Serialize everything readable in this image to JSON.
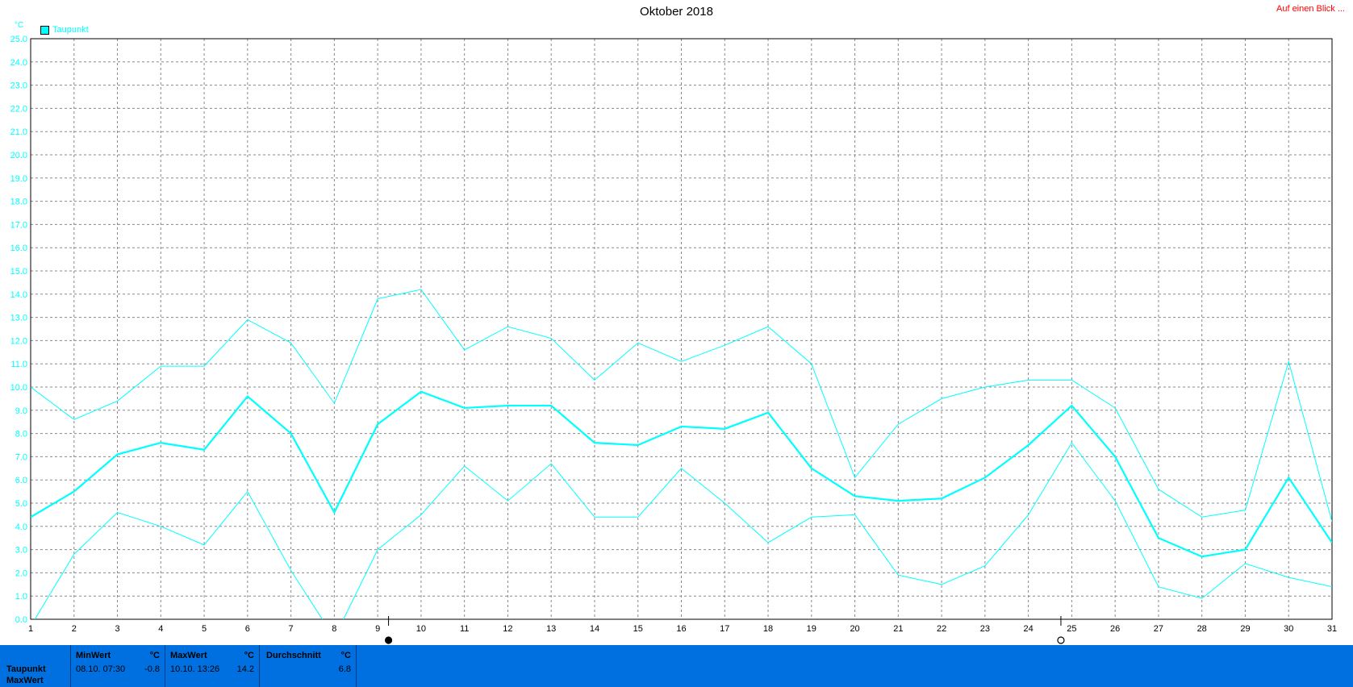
{
  "header": {
    "title": "Oktober 2018",
    "link": "Auf einen Blick ...",
    "unit": "°C",
    "legend": "Taupunkt"
  },
  "colors": {
    "series": "#00ffff",
    "panel": "#0070e0",
    "link": "#ff0000"
  },
  "chart_data": {
    "type": "line",
    "title": "Oktober 2018",
    "ylabel": "°C",
    "ylim": [
      0,
      25
    ],
    "yticks": [
      "0.0",
      "1.0",
      "2.0",
      "3.0",
      "4.0",
      "5.0",
      "6.0",
      "7.0",
      "8.0",
      "9.0",
      "10.0",
      "11.0",
      "12.0",
      "13.0",
      "14.0",
      "15.0",
      "16.0",
      "17.0",
      "18.0",
      "19.0",
      "20.0",
      "21.0",
      "22.0",
      "23.0",
      "24.0",
      "25.0"
    ],
    "x": [
      1,
      2,
      3,
      4,
      5,
      6,
      7,
      8,
      9,
      10,
      11,
      12,
      13,
      14,
      15,
      16,
      17,
      18,
      19,
      20,
      21,
      22,
      23,
      24,
      25,
      26,
      27,
      28,
      29,
      30,
      31
    ],
    "grid": true,
    "legend_position": "top-left",
    "series": [
      {
        "name": "Taupunkt",
        "values": [
          4.4,
          5.5,
          7.1,
          7.6,
          7.3,
          9.6,
          8.0,
          4.6,
          8.4,
          9.8,
          9.1,
          9.2,
          9.2,
          7.6,
          7.5,
          8.3,
          8.2,
          8.9,
          6.5,
          5.3,
          5.1,
          5.2,
          6.1,
          7.5,
          9.2,
          7.0,
          3.5,
          2.7,
          3.0,
          6.1,
          3.3
        ]
      },
      {
        "values": [
          10.0,
          8.6,
          9.4,
          10.9,
          10.9,
          12.9,
          11.9,
          9.3,
          13.8,
          14.2,
          11.6,
          12.6,
          12.1,
          10.3,
          11.9,
          11.1,
          11.8,
          12.6,
          11.0,
          6.1,
          8.4,
          9.5,
          10.0,
          10.3,
          10.3,
          9.1,
          5.6,
          4.4,
          4.7,
          11.1,
          4.2
        ]
      },
      {
        "values": [
          -0.3,
          2.8,
          4.6,
          4.0,
          3.2,
          5.5,
          2.1,
          -0.8,
          3.0,
          4.5,
          6.6,
          5.1,
          6.7,
          4.4,
          4.4,
          6.5,
          5.0,
          3.3,
          4.4,
          4.5,
          1.9,
          1.5,
          2.3,
          4.5,
          7.6,
          5.1,
          1.4,
          0.9,
          2.4,
          1.8,
          1.4
        ]
      }
    ],
    "moon_markers": [
      {
        "x": 9.25,
        "phase": "new-moon"
      },
      {
        "x": 24.75,
        "phase": "full-moon"
      }
    ]
  },
  "stats": {
    "row_labels": [
      "Taupunkt",
      "MaxWert"
    ],
    "min": {
      "label": "MinWert",
      "unit": "°C",
      "time": "08.10.  07:30",
      "value": "-0.8"
    },
    "max": {
      "label": "MaxWert",
      "unit": "°C",
      "time": "10.10.  13:26",
      "value": "14.2"
    },
    "avg": {
      "label": "Durchschnitt",
      "unit": "°C",
      "value": "6.8"
    }
  }
}
